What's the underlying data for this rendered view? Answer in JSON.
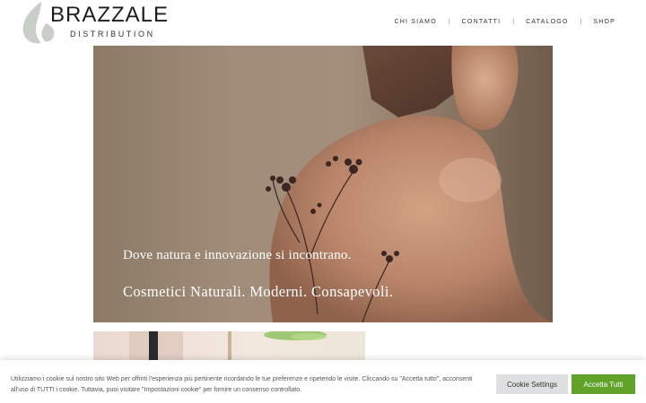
{
  "header": {
    "brand": "BRAZZALE",
    "brand_sub": "DISTRIBUTION",
    "logo_icon": "leaf-drop-icon",
    "nav": [
      {
        "label": "CHI SIAMO"
      },
      {
        "label": "CONTATTI"
      },
      {
        "label": "CATALOGO"
      },
      {
        "label": "SHOP"
      }
    ],
    "nav_separator": "|"
  },
  "hero": {
    "line1": "Dove natura e innovazione si incontrano.",
    "line2": "Cosmetici Naturali. Moderni. Consapevoli."
  },
  "cookie": {
    "text": "Utilizziamo i cookie sul nostro sito Web per offrirti l'esperienza più pertinente ricordando le tue preferenze e ripetendo le visite. Cliccando su \"Accetta tutto\", acconsenti all'uso di TUTTI i cookie. Tuttavia, puoi visitare \"Impostazioni cookie\" per fornire un consenso controllato.",
    "settings_label": "Cookie Settings",
    "accept_label": "Accetta Tutti"
  },
  "colors": {
    "accent_green": "#61a229",
    "settings_gray": "#dedfe0",
    "logo_gray": "#c9cec8"
  }
}
